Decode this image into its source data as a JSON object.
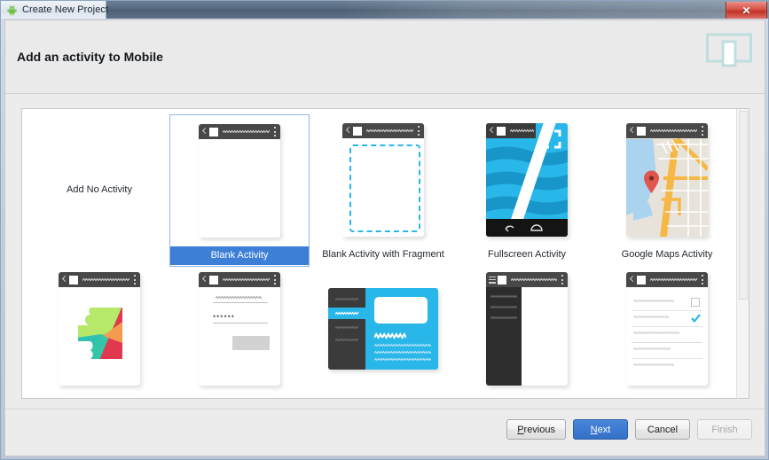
{
  "window": {
    "title": "Create New Project",
    "app_icon": "android-robot-icon",
    "close_label": "✕"
  },
  "header": {
    "title": "Add an activity to Mobile",
    "icon": "mobile-device-preview-icon"
  },
  "colors": {
    "selection_blue": "#3d7fd6",
    "android_green": "#6fbd44",
    "accent_cyan": "#29b6e8",
    "header_icon_teal": "#bfdedd",
    "appbar_dark": "#484848",
    "close_red": "#c13225"
  },
  "templates": [
    {
      "label": "Add No Activity",
      "kind": "none",
      "selected": false
    },
    {
      "label": "Blank Activity",
      "kind": "blank",
      "selected": true
    },
    {
      "label": "Blank Activity with Fragment",
      "kind": "blank-fragment",
      "selected": false
    },
    {
      "label": "Fullscreen Activity",
      "kind": "fullscreen",
      "selected": false
    },
    {
      "label": "Google Maps Activity",
      "kind": "maps",
      "selected": false
    },
    {
      "label": "",
      "kind": "play-services",
      "selected": false
    },
    {
      "label": "",
      "kind": "login",
      "selected": false
    },
    {
      "label": "",
      "kind": "master-detail",
      "selected": false
    },
    {
      "label": "",
      "kind": "nav-drawer",
      "selected": false
    },
    {
      "label": "",
      "kind": "settings",
      "selected": false
    }
  ],
  "scrollbar": {
    "orientation": "vertical",
    "thumb_position_pct": 0,
    "thumb_size_pct": 66
  },
  "footer": {
    "buttons": [
      {
        "label": "Previous",
        "mnemonic": "P",
        "style": "normal",
        "enabled": true
      },
      {
        "label": "Next",
        "mnemonic": "N",
        "style": "primary",
        "enabled": true
      },
      {
        "label": "Cancel",
        "mnemonic": "",
        "style": "normal",
        "enabled": true
      },
      {
        "label": "Finish",
        "mnemonic": "",
        "style": "disabled",
        "enabled": false
      }
    ]
  }
}
